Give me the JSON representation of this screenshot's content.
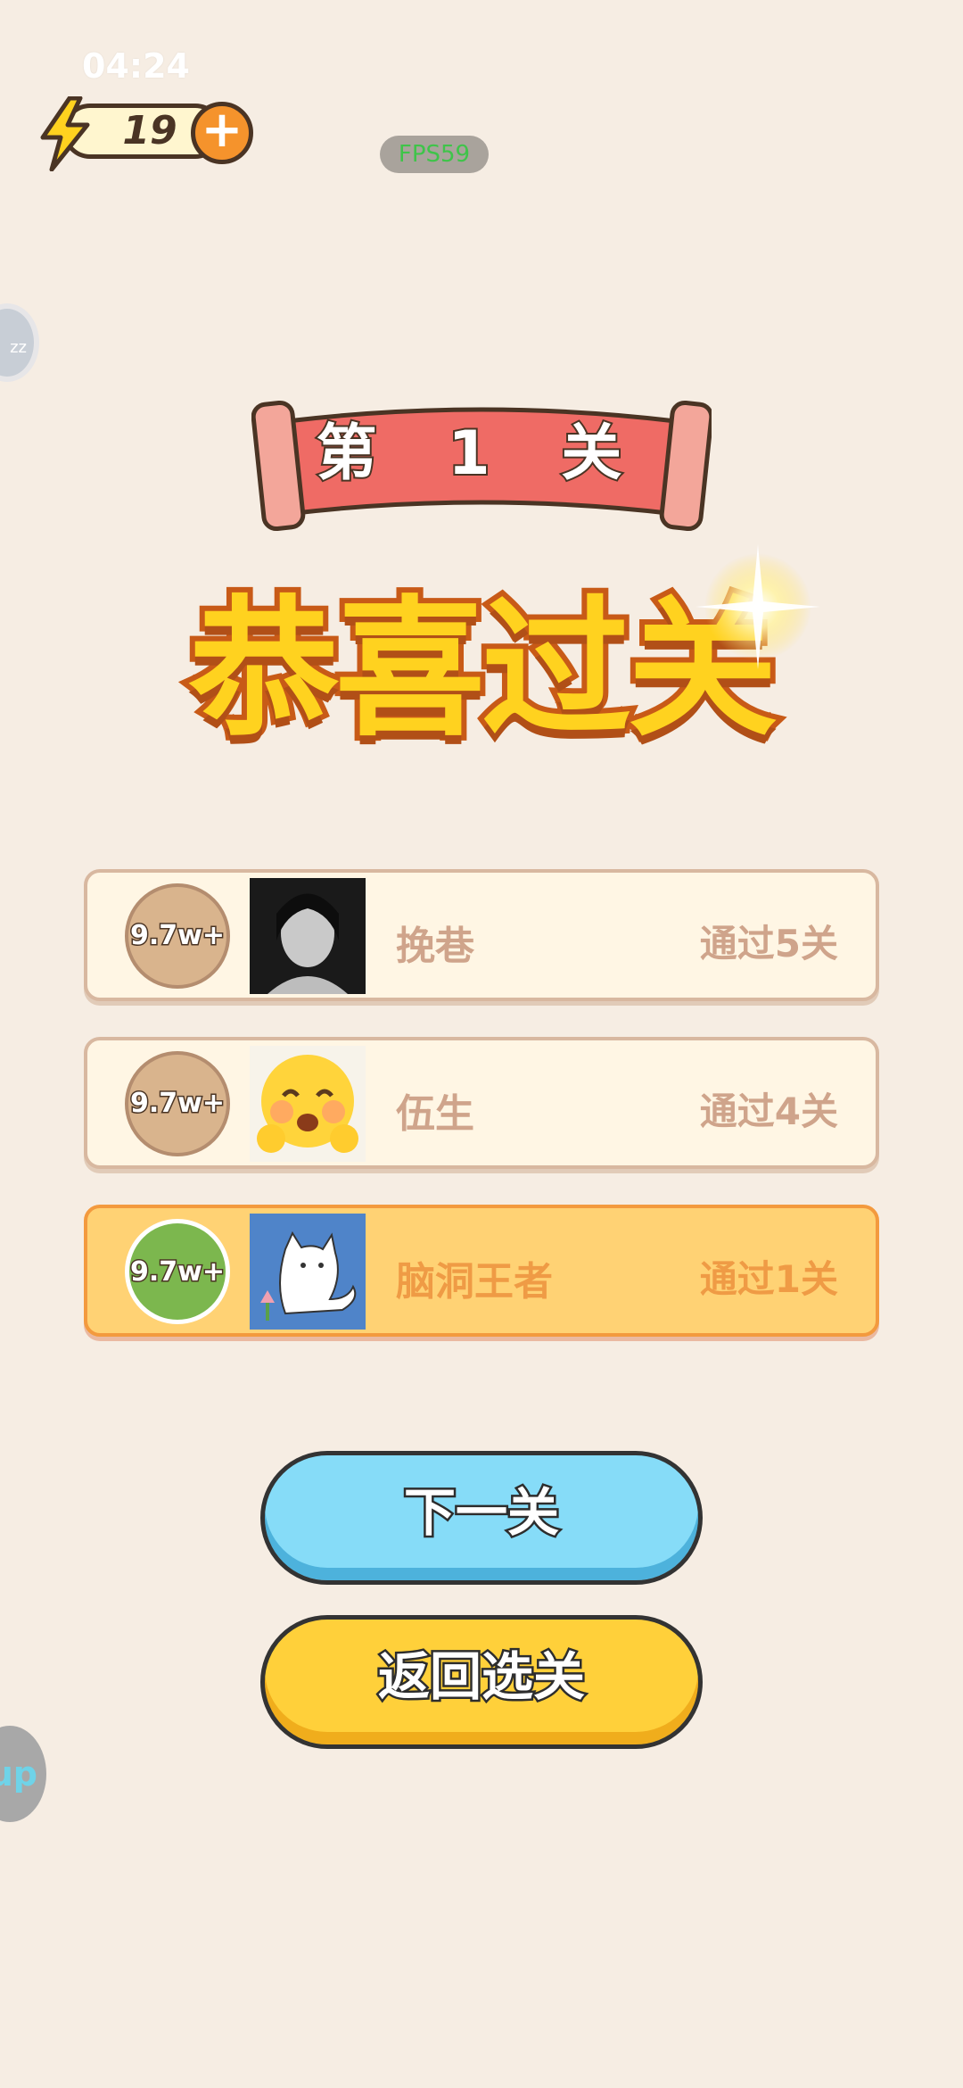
{
  "status": {
    "time": "04:24",
    "fps": "FPS59"
  },
  "energy": {
    "value": "19",
    "plus": "+"
  },
  "side": {
    "left_top": "zz",
    "left_bottom": "up"
  },
  "level": {
    "label": "第 1 关"
  },
  "title": "恭喜过关",
  "ranking": [
    {
      "badge": "9.7w+",
      "name": "挽巷",
      "progress": "通过5关",
      "is_self": false
    },
    {
      "badge": "9.7w+",
      "name": "伍生",
      "progress": "通过4关",
      "is_self": false
    },
    {
      "badge": "9.7w+",
      "name": "脑洞王者",
      "progress": "通过1关",
      "is_self": true
    }
  ],
  "buttons": {
    "next": "下一关",
    "back": "返回选关"
  },
  "colors": {
    "banner_red": "#ef6b65",
    "title_yellow": "#ffd21f",
    "self_row": "#ffd274",
    "next_btn": "#86dcf8",
    "back_btn": "#ffd03a"
  }
}
